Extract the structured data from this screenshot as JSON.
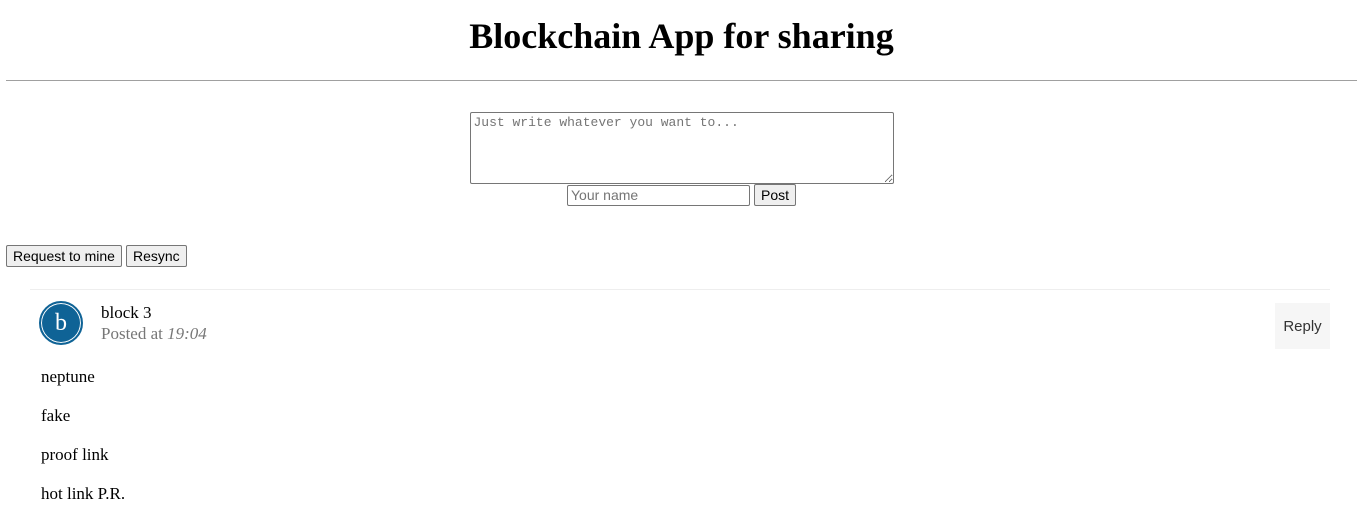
{
  "header": {
    "title": "Blockchain App for sharing"
  },
  "form": {
    "content_placeholder": "Just write whatever you want to...",
    "name_placeholder": "Your name",
    "post_label": "Post"
  },
  "actions": {
    "mine_label": "Request to mine",
    "resync_label": "Resync"
  },
  "posts": [
    {
      "avatar_letter": "b",
      "author": "block 3",
      "posted_prefix": "Posted at",
      "time": "19:04",
      "reply_label": "Reply",
      "lines": [
        "neptune",
        "fake",
        "proof link",
        "hot link P.R."
      ]
    }
  ],
  "colors": {
    "avatar": "#0f6396",
    "reply_bg": "#f6f6f6",
    "meta_text": "#777777"
  }
}
